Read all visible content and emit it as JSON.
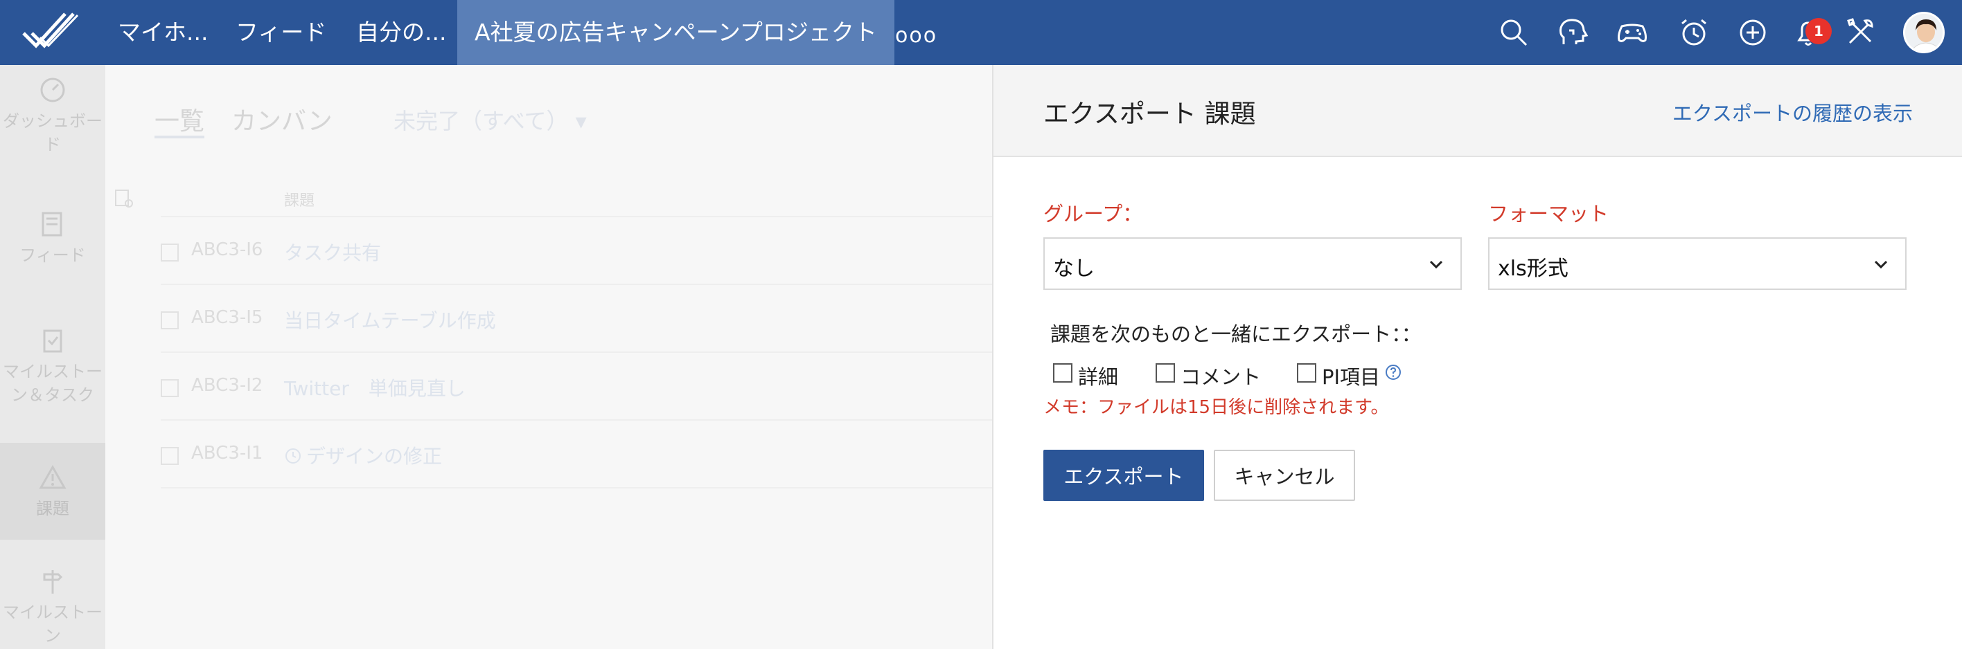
{
  "topbar": {
    "tabs": [
      {
        "label": "マイホ..."
      },
      {
        "label": "フィード"
      },
      {
        "label": "自分の..."
      },
      {
        "label": "A社夏の広告キャンペーンプロジェクト"
      }
    ],
    "more_label": "ooo",
    "notification_count": "1",
    "icons": [
      "search-icon",
      "chat-icon",
      "gamepad-icon",
      "timer-icon",
      "add-icon",
      "bell-icon",
      "tools-icon"
    ]
  },
  "sidebar": {
    "items": [
      {
        "label": "ダッシュボード",
        "icon": "dashboard-icon"
      },
      {
        "label": "フィード",
        "icon": "feed-icon"
      },
      {
        "label": "マイルストーン＆タスク",
        "icon": "clipboard-icon"
      },
      {
        "label": "課題",
        "icon": "warning-icon"
      },
      {
        "label": "マイルストーン",
        "icon": "signpost-icon"
      }
    ]
  },
  "background": {
    "tabs": [
      "一覧",
      "カンバン"
    ],
    "filter": "未完了（すべて）",
    "column_header": "課題",
    "rows": [
      {
        "id": "ABC3-I6",
        "title": "タスク共有"
      },
      {
        "id": "ABC3-I5",
        "title": "当日タイムテーブル作成"
      },
      {
        "id": "ABC3-I2",
        "title": "Twitter　単価見直し"
      },
      {
        "id": "ABC3-I1",
        "title": "デザインの修正"
      }
    ]
  },
  "panel": {
    "title": "エクスポート 課題",
    "history_link": "エクスポートの履歴の表示",
    "group_label": "グループ：",
    "group_value": "なし",
    "format_label": "フォーマット",
    "format_value": "xls形式",
    "with_label": "課題を次のものと一緒にエクスポート：：",
    "options": [
      "詳細",
      "コメント",
      "PI項目"
    ],
    "memo": "メモ：ファイルは15日後に削除されます。",
    "export_button": "エクスポート",
    "cancel_button": "キャンセル"
  },
  "colors": {
    "brand": "#2b5597",
    "active_tab": "#5a7fb7",
    "alert": "#d23a2a",
    "link": "#2f6ab5"
  }
}
